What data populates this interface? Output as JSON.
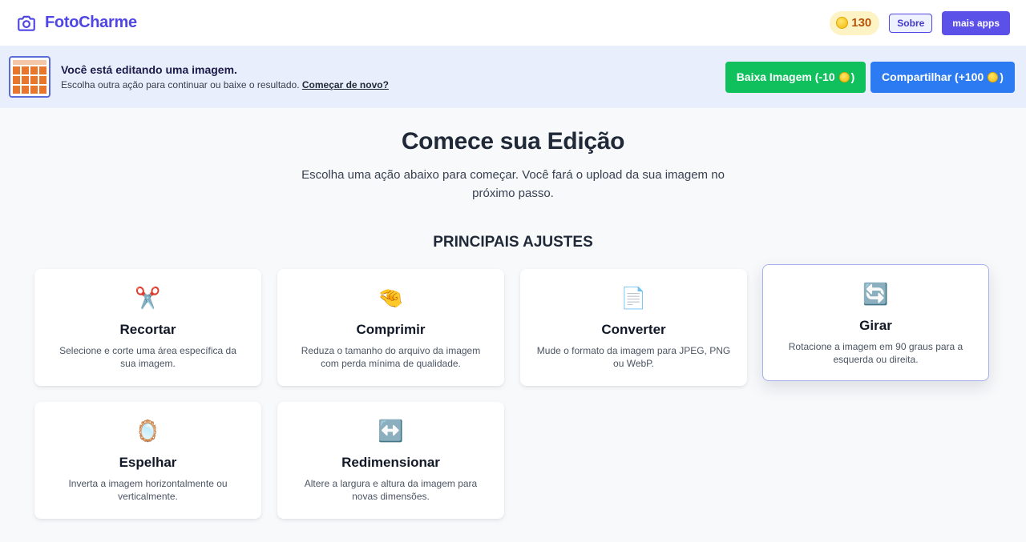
{
  "header": {
    "brand": "FotoCharme",
    "coins": "130",
    "about_label": "Sobre",
    "more_apps_label": "mais apps"
  },
  "banner": {
    "title": "Você está editando uma imagem.",
    "subtitle": "Escolha outra ação para continuar ou baixe o resultado.",
    "restart_link": "Começar de novo?",
    "download_label": "Baixa Imagem (-10",
    "share_label": "Compartilhar (+100",
    "close_paren": ")"
  },
  "main": {
    "title": "Comece sua Edição",
    "subtitle": "Escolha uma ação abaixo para começar. Você fará o upload da sua imagem no próximo passo.",
    "section_title": "PRINCIPAIS AJUSTES"
  },
  "cards": [
    {
      "icon": "scissors-icon",
      "glyph": "✂️",
      "title": "Recortar",
      "desc": "Selecione e corte uma área específica da sua imagem."
    },
    {
      "icon": "pinching-hand-icon",
      "glyph": "🤏",
      "title": "Comprimir",
      "desc": "Reduza o tamanho do arquivo da imagem com perda mínima de qualidade."
    },
    {
      "icon": "document-icon",
      "glyph": "📄",
      "title": "Converter",
      "desc": "Mude o formato da imagem para JPEG, PNG ou WebP."
    },
    {
      "icon": "rotate-icon",
      "glyph": "🔄",
      "title": "Girar",
      "desc": "Rotacione a imagem em 90 graus para a esquerda ou direita."
    },
    {
      "icon": "mirror-icon",
      "glyph": "🪞",
      "title": "Espelhar",
      "desc": "Inverta a imagem horizontalmente ou verticalmente."
    },
    {
      "icon": "left-right-arrow-icon",
      "glyph": "↔️",
      "title": "Redimensionar",
      "desc": "Altere a largura e altura da imagem para novas dimensões."
    }
  ],
  "colors": {
    "brand": "#4f46e5",
    "download": "#10c05d",
    "share": "#2c7bf2",
    "banner_bg": "#e8eefc"
  }
}
